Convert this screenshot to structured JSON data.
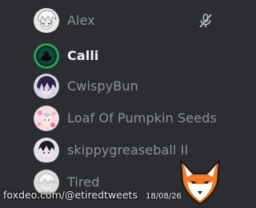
{
  "members": [
    {
      "name": "Alex",
      "color": "#8e9297",
      "muted": true,
      "avatar_icon": "anime-avatar-white-hair"
    },
    {
      "name": "Calli",
      "color": "#f2f3f5",
      "muted": false,
      "avatar_icon": "dark-avatar-green-ring"
    },
    {
      "name": "CwispyBun",
      "color": "#8e9297",
      "muted": false,
      "avatar_icon": "anime-avatar-purple"
    },
    {
      "name": "Loaf Of Pumpkin Seeds",
      "color": "#8e9297",
      "muted": false,
      "avatar_icon": "anime-avatar-pink-flowers"
    },
    {
      "name": "skippygreaseball II",
      "color": "#8e9297",
      "muted": false,
      "avatar_icon": "anime-avatar-dark-hair"
    },
    {
      "name": "Tired",
      "color": "#8e9297",
      "muted": false,
      "avatar_icon": "anime-avatar-grey"
    }
  ],
  "watermark": {
    "source": "foxdeo.com/@etiredtweets",
    "date": "18/08/26",
    "logo_icon": "fox-logo-icon"
  }
}
